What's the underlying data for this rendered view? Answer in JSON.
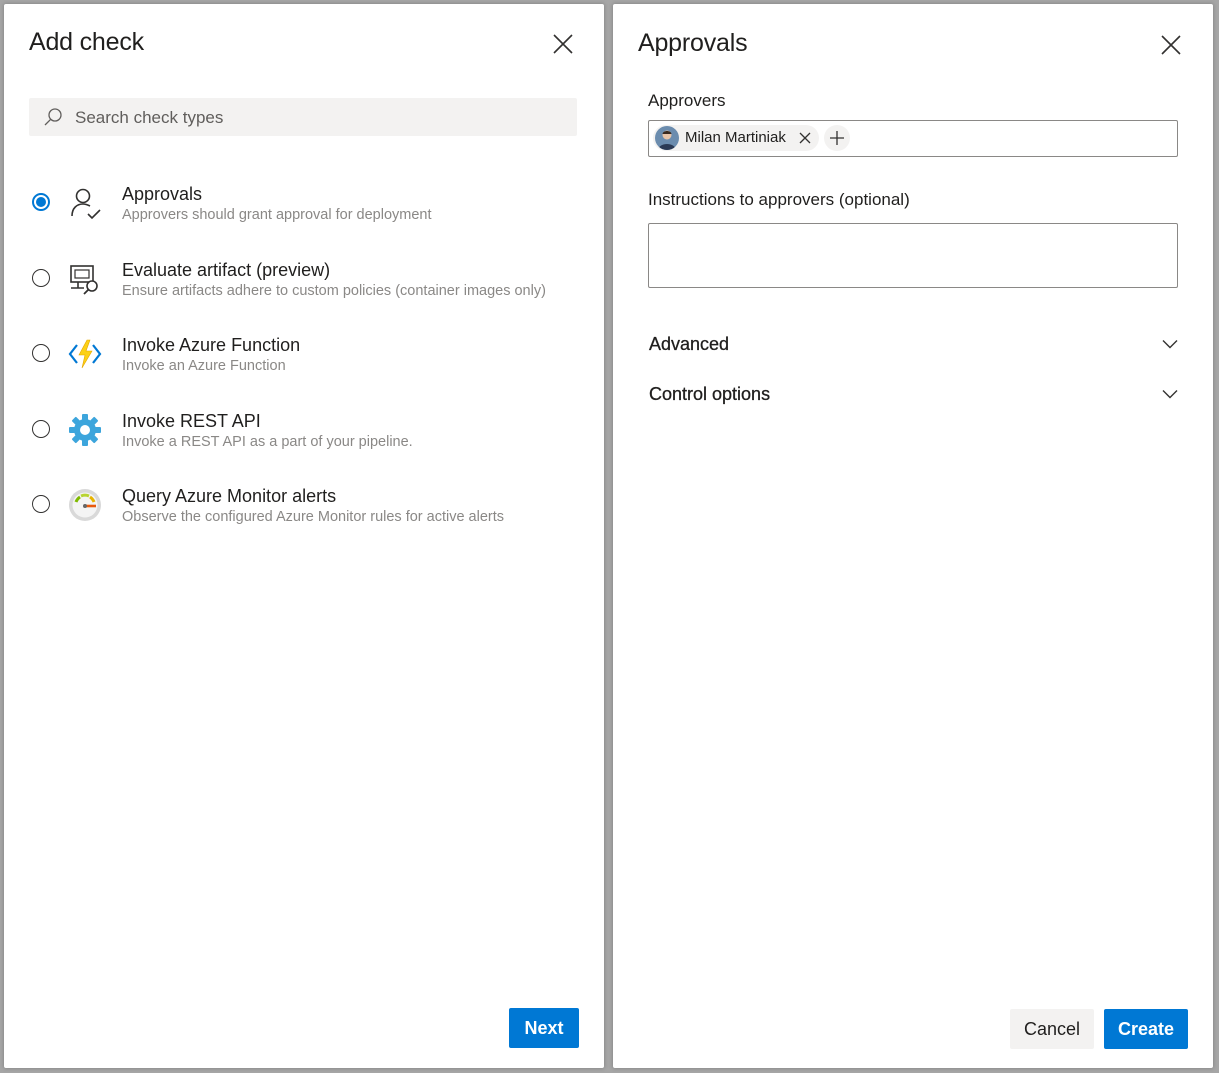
{
  "add_check": {
    "title": "Add check",
    "search_placeholder": "Search check types",
    "check_types": [
      {
        "title": "Approvals",
        "description": "Approvers should grant approval for deployment",
        "icon": "user-check-icon",
        "selected": true
      },
      {
        "title": "Evaluate artifact (preview)",
        "description": "Ensure artifacts adhere to custom policies (container images only)",
        "icon": "artifact-search-icon",
        "selected": false
      },
      {
        "title": "Invoke Azure Function",
        "description": "Invoke an Azure Function",
        "icon": "azure-function-icon",
        "selected": false
      },
      {
        "title": "Invoke REST API",
        "description": "Invoke a REST API as a part of your pipeline.",
        "icon": "gear-icon",
        "selected": false
      },
      {
        "title": "Query Azure Monitor alerts",
        "description": "Observe the configured Azure Monitor rules for active alerts",
        "icon": "monitor-gauge-icon",
        "selected": false
      }
    ],
    "next_label": "Next"
  },
  "approvals": {
    "title": "Approvals",
    "approvers_label": "Approvers",
    "approvers": [
      {
        "name": "Milan Martiniak"
      }
    ],
    "instructions_label": "Instructions to approvers (optional)",
    "instructions_value": "",
    "sections": [
      {
        "label": "Advanced",
        "expanded": false
      },
      {
        "label": "Control options",
        "expanded": false
      }
    ],
    "cancel_label": "Cancel",
    "create_label": "Create"
  },
  "colors": {
    "accent": "#0078d4",
    "backdrop": "#a6a6a6",
    "muted_text": "#8a8886"
  }
}
